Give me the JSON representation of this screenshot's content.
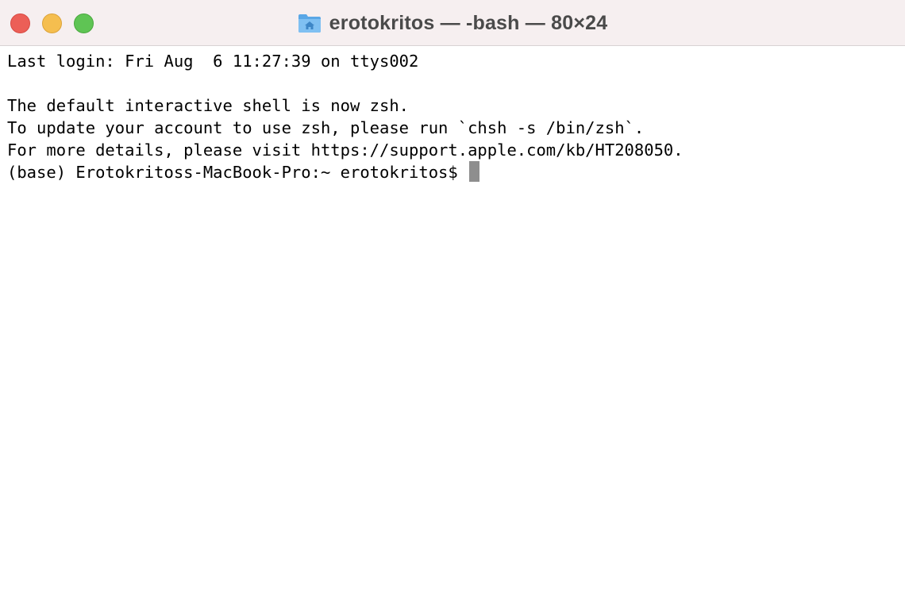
{
  "window": {
    "title": "erotokritos — -bash — 80×24"
  },
  "icons": {
    "close": "close-button",
    "minimize": "minimize-button",
    "zoom": "zoom-button",
    "folder": "home-folder-icon"
  },
  "colors": {
    "titlebar": "#f6eff0",
    "close": "#ec5f57",
    "minimize": "#f5be4f",
    "zoom": "#5fc454",
    "cursor": "#8e8e8e",
    "text": "#000000"
  },
  "terminal": {
    "lines": [
      "Last login: Fri Aug  6 11:27:39 on ttys002",
      "",
      "The default interactive shell is now zsh.",
      "To update your account to use zsh, please run `chsh -s /bin/zsh`.",
      "For more details, please visit https://support.apple.com/kb/HT208050."
    ],
    "prompt": "(base) Erotokritoss-MacBook-Pro:~ erotokritos$ "
  }
}
